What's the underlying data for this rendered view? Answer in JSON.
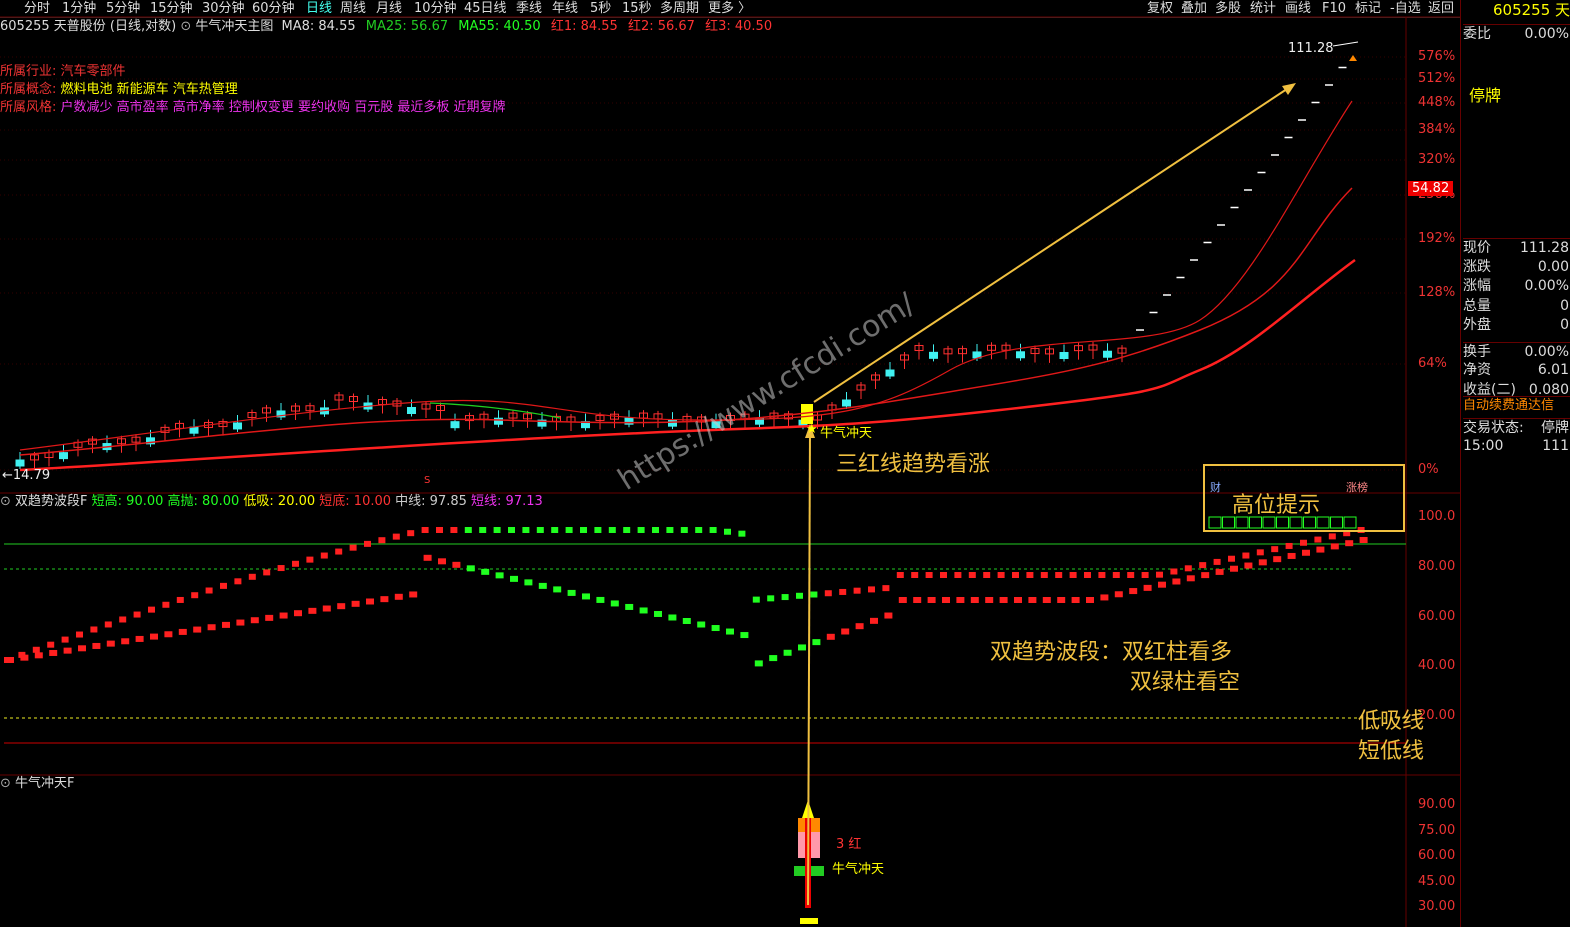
{
  "toolbar": {
    "periods": [
      "分时",
      "1分钟",
      "5分钟",
      "15分钟",
      "30分钟",
      "60分钟",
      "日线",
      "周线",
      "月线",
      "10分钟",
      "45日线",
      "季线",
      "年线",
      "5秒",
      "15秒",
      "多周期",
      "更多 〉"
    ],
    "active": "日线",
    "right_buttons": [
      "复权",
      "叠加",
      "多股",
      "统计",
      "画线",
      "F10",
      "标记",
      "-自选",
      "返回"
    ]
  },
  "title": {
    "stock": "605255 天普股份 (日线,对数)",
    "indicator": "牛气冲天主图",
    "ma8": "MA8: 84.55",
    "ma25": "MA25: 56.67",
    "ma55": "MA55: 40.50",
    "red1": "红1: 84.55",
    "red2": "红2: 56.67",
    "red3": "红3: 40.50"
  },
  "info": {
    "industry_label": "所属行业:",
    "industry": "汽车零部件",
    "concept_label": "所属概念:",
    "concept": "燃料电池 新能源车 汽车热管理",
    "style_label": "所属风格:",
    "style": "户数减少 高市盈率 高市净率 控制权变更 要约收购 百元股 最近多板 近期复牌"
  },
  "main_axis": [
    "576%",
    "512%",
    "448%",
    "384%",
    "320%",
    "256%",
    "192%",
    "128%",
    "64%",
    "0%"
  ],
  "price_tag": "54.82",
  "high_label": "111.28",
  "low_label": "←14.79",
  "mid_marker": "牛气冲天",
  "mid_star": "★",
  "s_marker": "S",
  "watermark": "https://www.cfcdi.com/",
  "annotations": {
    "trend": "三红线趋势看涨",
    "wave1": "双趋势波段：双红柱看多",
    "wave2": "双绿柱看空",
    "low_buy": "低吸线",
    "short_low": "短低线",
    "high_hint": "高位提示",
    "cai": "财",
    "zhangbang": "涨榜",
    "three_red": "3  红",
    "bull": "牛气冲天"
  },
  "panel2": {
    "name": "双趋势波段F",
    "short_high": "短高: 90.00",
    "high_throw": "高抛: 80.00",
    "low_buy": "低吸: 20.00",
    "short_bottom": "短底: 10.00",
    "mid": "中线: 97.85",
    "short": "短线: 97.13",
    "axis": [
      "100.0",
      "80.00",
      "60.00",
      "40.00",
      "20.00"
    ]
  },
  "panel3": {
    "name": "牛气冲天F",
    "axis": [
      "90.00",
      "75.00",
      "60.00",
      "45.00",
      "30.00"
    ]
  },
  "side": {
    "code": "605255 天",
    "weibi_label": "委比",
    "weibi": "0.00%",
    "halt": "停牌",
    "rows": [
      {
        "label": "现价",
        "val": "111.28"
      },
      {
        "label": "涨跌",
        "val": "0.00"
      },
      {
        "label": "涨幅",
        "val": "0.00%"
      },
      {
        "label": "总量",
        "val": "0"
      },
      {
        "label": "外盘",
        "val": "0"
      },
      {
        "label": "换手",
        "val": "0.00%"
      },
      {
        "label": "净资",
        "val": "6.01"
      },
      {
        "label": "收益(二)",
        "val": "0.080"
      }
    ],
    "renew": "自动续费通达信",
    "trade_state_label": "交易状态:",
    "trade_state": "停牌",
    "time": "15:00",
    "time_val": "111"
  },
  "colors": {
    "red": "#ff2020",
    "green": "#20ff20",
    "cyan": "#40f0f0",
    "yellow": "#ffd040",
    "bg": "#000000"
  }
}
